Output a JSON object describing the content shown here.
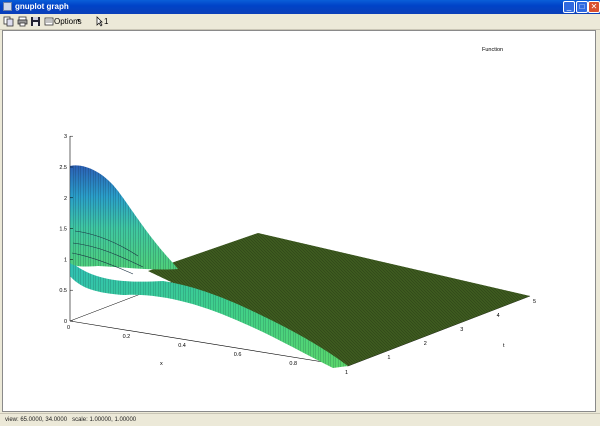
{
  "window": {
    "title": "gnuplot graph"
  },
  "toolbar": {
    "options_label": "Options",
    "plot_count": "1"
  },
  "plot": {
    "key_label": "Function",
    "xlabel": "x",
    "tlabel": "t",
    "z_ticks": [
      "0",
      "0.5",
      "1",
      "1.5",
      "2",
      "2.5",
      "3"
    ],
    "x_ticks": [
      "0",
      "0.2",
      "0.4",
      "0.6",
      "0.8",
      "1"
    ],
    "t_ticks": [
      "1",
      "2",
      "3",
      "4",
      "5"
    ]
  },
  "status": {
    "view_label": "view:",
    "view": "65.0000, 34.0000",
    "scale_label": "scale:",
    "scale": "1.00000, 1.00000"
  },
  "colors": {
    "surface_top": "#3d5a1f",
    "surface_mid": "#4fd07a",
    "surface_hi": "#2a9fc9",
    "surface_peak": "#2b5fb5"
  }
}
